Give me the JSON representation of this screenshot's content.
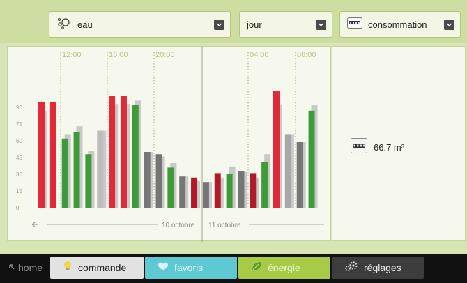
{
  "filters": {
    "resource": {
      "label": "eau",
      "icon": "water-drops-icon"
    },
    "period": {
      "label": "jour"
    },
    "mode": {
      "label": "consommation",
      "icon": "meter-icon"
    }
  },
  "chart_data": {
    "type": "bar",
    "y_ticks": [
      "0",
      "15",
      "30",
      "45",
      "60",
      "75",
      "90"
    ],
    "time_labels": [
      "12:00",
      "16:00",
      "20:00",
      "04:00",
      "08:00"
    ],
    "date_labels": [
      "10 octobre",
      "11 octobre"
    ],
    "ylim": [
      0,
      110
    ],
    "bars": [
      {
        "value": 95,
        "prev": 87,
        "color": "#e02a3a"
      },
      {
        "value": 95,
        "prev": 0,
        "color": "#e02a3a"
      },
      {
        "value": 62,
        "prev": 66,
        "color": "#3f9a3a"
      },
      {
        "value": 68,
        "prev": 73,
        "color": "#3f9a3a"
      },
      {
        "value": 48,
        "prev": 51,
        "color": "#3f9a3a"
      },
      {
        "value": 69,
        "prev": 69,
        "color": "#bdbdbd"
      },
      {
        "value": 100,
        "prev": 93,
        "color": "#e02a3a"
      },
      {
        "value": 100,
        "prev": 93,
        "color": "#e02a3a"
      },
      {
        "value": 92,
        "prev": 96,
        "color": "#3f9a3a"
      },
      {
        "value": 50,
        "prev": 50,
        "color": "#767676"
      },
      {
        "value": 48,
        "prev": 46,
        "color": "#767676"
      },
      {
        "value": 36,
        "prev": 40,
        "color": "#3f9a3a"
      },
      {
        "value": 28,
        "prev": 28,
        "color": "#767676"
      },
      {
        "value": 27,
        "prev": 24,
        "color": "#b21a2a"
      },
      {
        "value": 23,
        "prev": 23,
        "color": "#767676"
      },
      {
        "value": 31,
        "prev": 27,
        "color": "#b21a2a"
      },
      {
        "value": 30,
        "prev": 37,
        "color": "#3f9a3a"
      },
      {
        "value": 33,
        "prev": 32,
        "color": "#767676"
      },
      {
        "value": 31,
        "prev": 27,
        "color": "#b21a2a"
      },
      {
        "value": 41,
        "prev": 48,
        "color": "#3f9a3a"
      },
      {
        "value": 105,
        "prev": 92,
        "color": "#e02a3a"
      },
      {
        "value": 66,
        "prev": 66,
        "color": "#a8a8a8"
      },
      {
        "value": 59,
        "prev": 59,
        "color": "#767676"
      },
      {
        "value": 87,
        "prev": 92,
        "color": "#3f9a3a"
      }
    ]
  },
  "info": {
    "value_text": "66.7 m³",
    "icon": "meter-icon"
  },
  "nav": {
    "home": "home",
    "commande": "commande",
    "favoris": "favoris",
    "energie": "énergie",
    "reglages": "réglages"
  },
  "colors": {
    "panel": "#d7e4b4",
    "accent_green": "#a8cb47",
    "red": "#e02a3a",
    "green": "#3f9a3a",
    "cyan": "#5ec8d3"
  }
}
